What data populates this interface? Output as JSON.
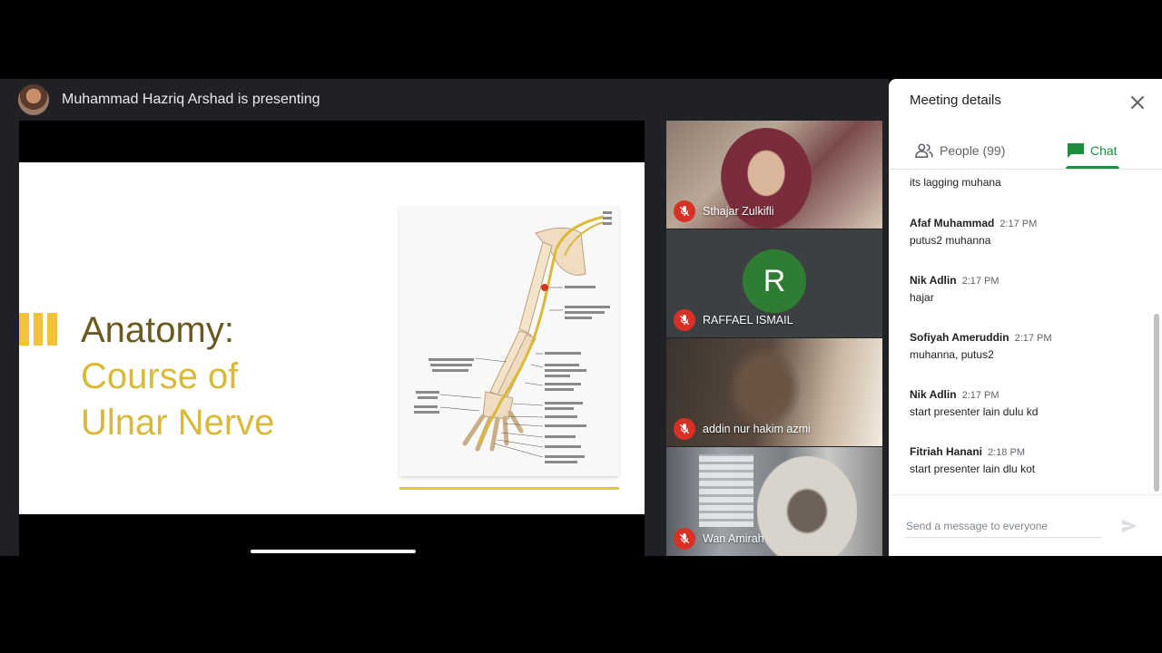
{
  "presenter": {
    "text": "Muhammad Hazriq Arshad is presenting"
  },
  "slide": {
    "title_line1": "Anatomy:",
    "title_line2": "Course of",
    "title_line3": "Ulnar Nerve"
  },
  "participants": [
    {
      "name": "Sthajar Zulkifli",
      "muted": true
    },
    {
      "name": "RAFFAEL ISMAIL",
      "initial": "R",
      "avatar_color": "#2f7d32",
      "muted": true
    },
    {
      "name": "addin nur hakim azmi",
      "muted": true
    },
    {
      "name": "Wan Amirah",
      "muted": true
    }
  ],
  "panel": {
    "title": "Meeting details",
    "tabs": {
      "people": "People (99)",
      "chat": "Chat"
    },
    "first_message": "its lagging muhana",
    "messages": [
      {
        "sender": "Afaf Muhammad",
        "time": "2:17 PM",
        "text": "putus2 muhanna"
      },
      {
        "sender": "Nik Adlin",
        "time": "2:17 PM",
        "text": "hajar"
      },
      {
        "sender": "Sofiyah Ameruddin",
        "time": "2:17 PM",
        "text": "muhanna, putus2"
      },
      {
        "sender": "Nik Adlin",
        "time": "2:17 PM",
        "text": "start presenter lain dulu kd"
      },
      {
        "sender": "Fitriah Hanani",
        "time": "2:18 PM",
        "text": "start presenter lain dlu kot"
      }
    ],
    "input_placeholder": "Send a message to everyone"
  },
  "colors": {
    "accent_green": "#1e8e3e",
    "mic_off_red": "#d93025",
    "slide_gold": "#d9b93a"
  }
}
